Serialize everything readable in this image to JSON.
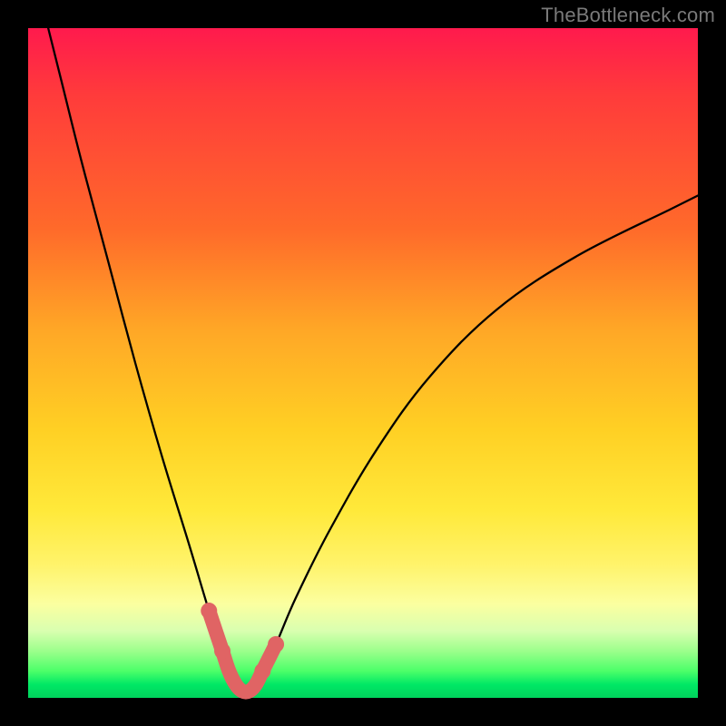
{
  "watermark": "TheBottleneck.com",
  "colors": {
    "frame": "#000000",
    "curve": "#000000",
    "marker": "#e06464",
    "gradient_top": "#ff1a4d",
    "gradient_bottom": "#00d25c"
  },
  "chart_data": {
    "type": "line",
    "title": "",
    "xlabel": "",
    "ylabel": "",
    "xlim": [
      0,
      100
    ],
    "ylim": [
      0,
      100
    ],
    "series": [
      {
        "name": "bottleneck-curve",
        "x": [
          3,
          5,
          8,
          12,
          16,
          20,
          24,
          27,
          29,
          30,
          31,
          32,
          33,
          34,
          35,
          37,
          40,
          45,
          52,
          60,
          70,
          82,
          96,
          100
        ],
        "values": [
          100,
          92,
          80,
          65,
          50,
          36,
          23,
          13,
          7,
          4,
          2,
          1,
          1,
          2,
          4,
          8,
          15,
          25,
          37,
          48,
          58,
          66,
          73,
          75
        ]
      }
    ],
    "annotations": [
      {
        "name": "valley-marker",
        "x": [
          27,
          29,
          30,
          31,
          32,
          33,
          34,
          35,
          37
        ],
        "values": [
          13,
          7,
          4,
          2,
          1,
          1,
          2,
          4,
          8
        ]
      }
    ]
  }
}
